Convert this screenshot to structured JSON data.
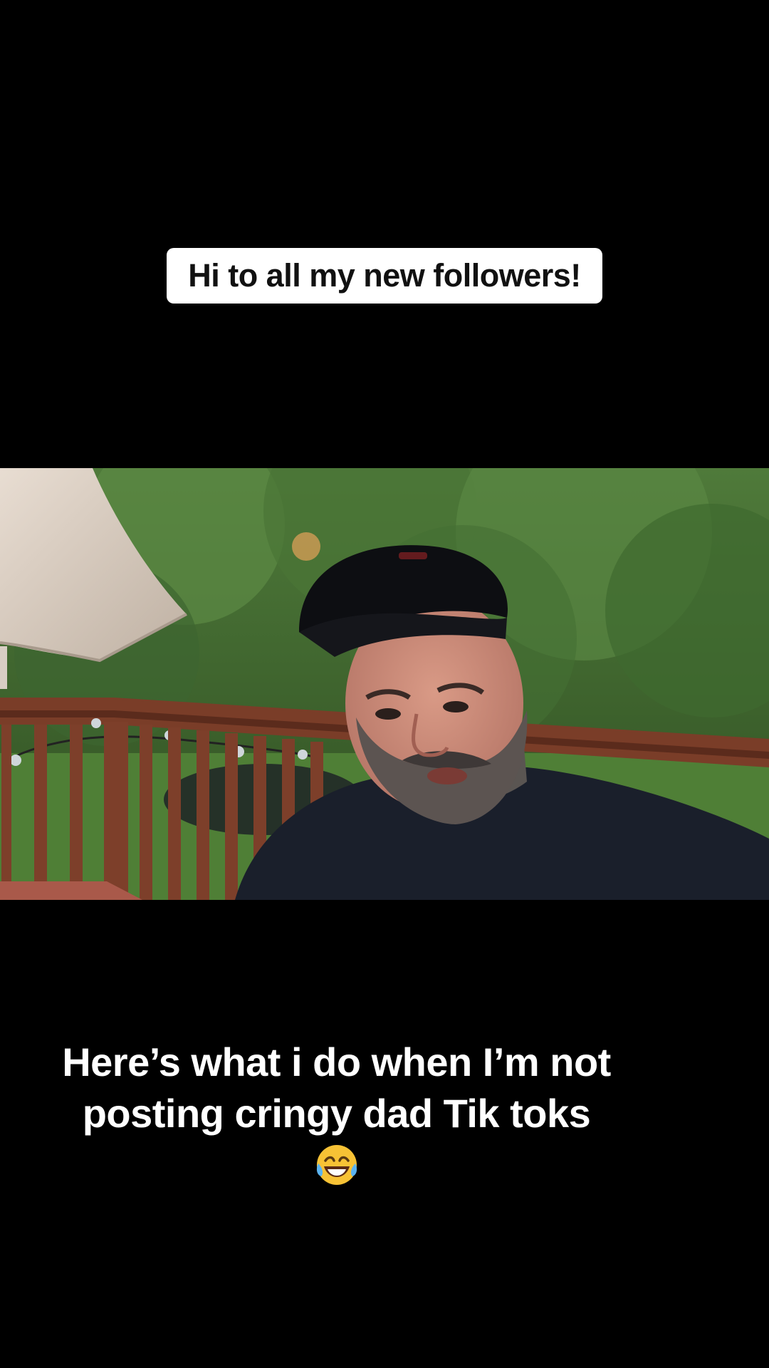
{
  "overlay": {
    "top_caption": "Hi to all my new followers!",
    "bottom_caption_line1": "Here’s what i do when I’m not",
    "bottom_caption_line2": "posting cringy dad Tik toks",
    "bottom_caption_emoji": "😂"
  },
  "video": {
    "scene": "man-in-black-cap-on-backyard-deck"
  },
  "icons": {
    "emoji": "face-with-tears-of-joy-icon"
  },
  "colors": {
    "background": "#000000",
    "caption_pill": "#ffffff",
    "caption_text": "#111111",
    "bottom_text": "#ffffff"
  }
}
